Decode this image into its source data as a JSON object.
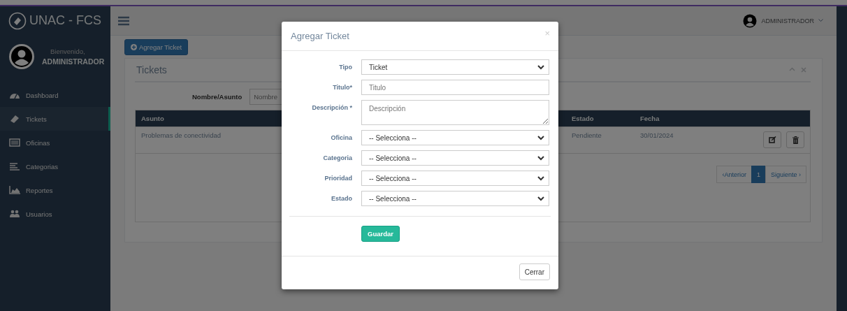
{
  "brand": {
    "title": "UNAC - FCS"
  },
  "profile": {
    "greeting": "Bienvenido,",
    "name": "ADMINISTRADOR"
  },
  "menu": [
    {
      "label": "Dashboard",
      "kind": "dashboard",
      "selected": false
    },
    {
      "label": "Tickets",
      "kind": "ticket",
      "selected": true
    },
    {
      "label": "Oficinas",
      "kind": "list",
      "selected": false
    },
    {
      "label": "Categorias",
      "kind": "lines",
      "selected": false
    },
    {
      "label": "Reportes",
      "kind": "chart",
      "selected": false
    },
    {
      "label": "Usuarios",
      "kind": "users",
      "selected": false
    }
  ],
  "topbar": {
    "user": "ADMINISTRADOR"
  },
  "add_button": "Agregar Ticket",
  "panel": {
    "title": "Tickets",
    "filter": {
      "label": "Nombre/Asunto",
      "placeholder": "Nombre"
    },
    "table": {
      "columns": [
        "Asunto",
        "Estado",
        "Fecha"
      ],
      "rows": [
        {
          "asunto": "Problemas de conectividad",
          "estado": "Pendiente",
          "fecha": "30/01/2024"
        }
      ]
    },
    "pagination": {
      "previous": "‹Anterior",
      "pages": [
        {
          "label": "1",
          "selected": true
        }
      ],
      "next": "Siguiente ›"
    }
  },
  "modal": {
    "title": "Agregar Ticket",
    "close_glyph": "×",
    "fields": [
      {
        "label": "Tipo",
        "kind": "select",
        "value": "Ticket"
      },
      {
        "label": "Titulo*",
        "kind": "text",
        "placeholder": "Titulo"
      },
      {
        "label": "Descripción *",
        "kind": "textarea",
        "placeholder": "Descripción"
      },
      {
        "label": "Oficina",
        "kind": "select",
        "value": "-- Selecciona --"
      },
      {
        "label": "Categoria",
        "kind": "select",
        "value": "-- Selecciona --"
      },
      {
        "label": "Prioridad",
        "kind": "select",
        "value": "-- Selecciona --"
      },
      {
        "label": "Estado",
        "kind": "select",
        "value": "-- Selecciona --"
      }
    ],
    "submit": "Guardar",
    "close": "Cerrar"
  }
}
